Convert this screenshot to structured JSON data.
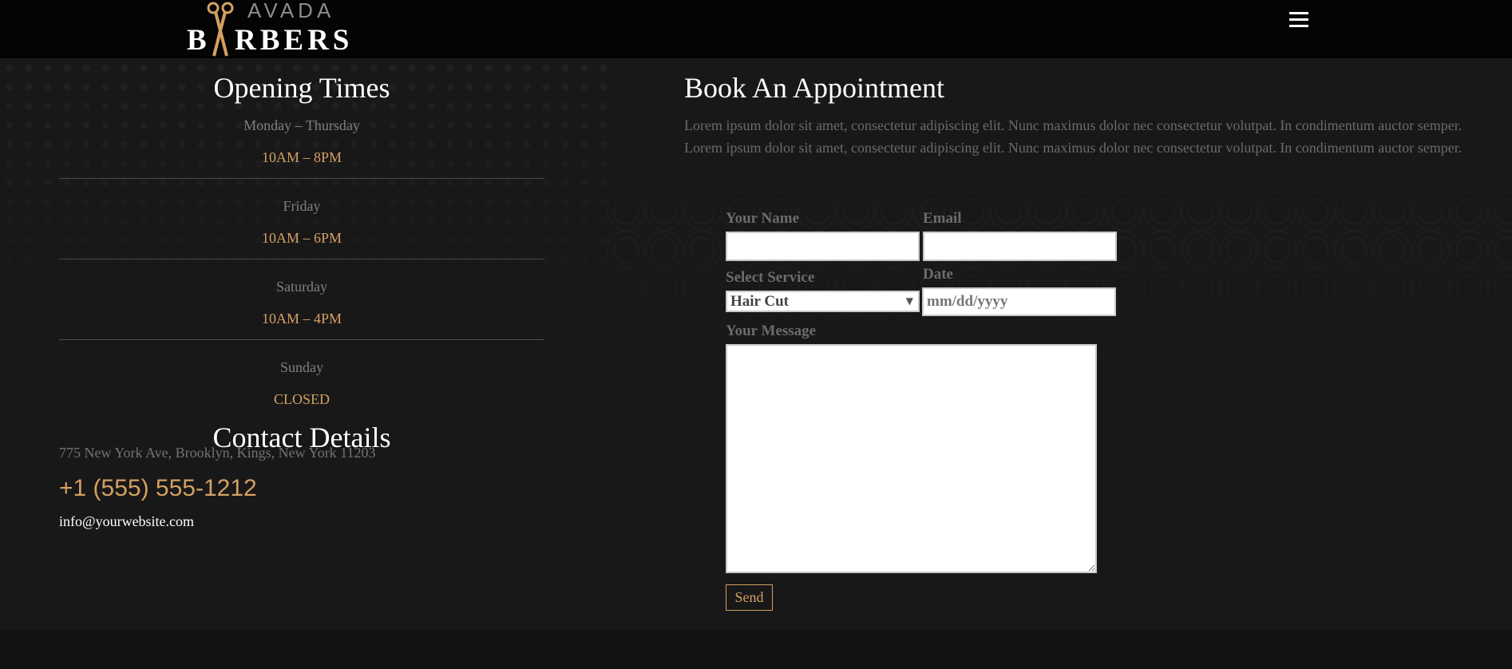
{
  "header": {
    "logo": {
      "line1": "AVADA",
      "line2_first": "B",
      "line2_rest": "RBERS"
    },
    "menu_icon": "hamburger-icon"
  },
  "hours": {
    "title": "Opening Times",
    "rows": [
      {
        "day": "Monday – Thursday",
        "time": "10AM – 8PM"
      },
      {
        "day": "Friday",
        "time": "10AM – 6PM"
      },
      {
        "day": "Saturday",
        "time": "10AM – 4PM"
      },
      {
        "day": "Sunday",
        "time": "CLOSED"
      }
    ]
  },
  "contact": {
    "title": "Contact Details",
    "address": "775 New York Ave, Brooklyn, Kings, New York 11203",
    "phone": "+1 (555) 555-1212",
    "email": "info@yourwebsite.com"
  },
  "booking": {
    "title": "Book An Appointment",
    "description": "Lorem ipsum dolor sit amet, consectetur adipiscing elit. Nunc maximus dolor nec consectetur volutpat. In condimentum auctor semper. Lorem ipsum dolor sit amet, consectetur adipiscing elit. Nunc maximus dolor nec consectetur volutpat. In condimentum auctor semper.",
    "name_label": "Your Name",
    "name_value": "",
    "email_label": "Email",
    "email_value": "",
    "service_label": "Select Service",
    "service_selected": "Hair Cut",
    "date_label": "Date",
    "date_placeholder": "mm/dd/yyyy",
    "message_label": "Your Message",
    "message_value": "",
    "send_label": "Send"
  },
  "colors": {
    "accent": "#d4a062",
    "background": "#181819",
    "header": "#040404"
  }
}
